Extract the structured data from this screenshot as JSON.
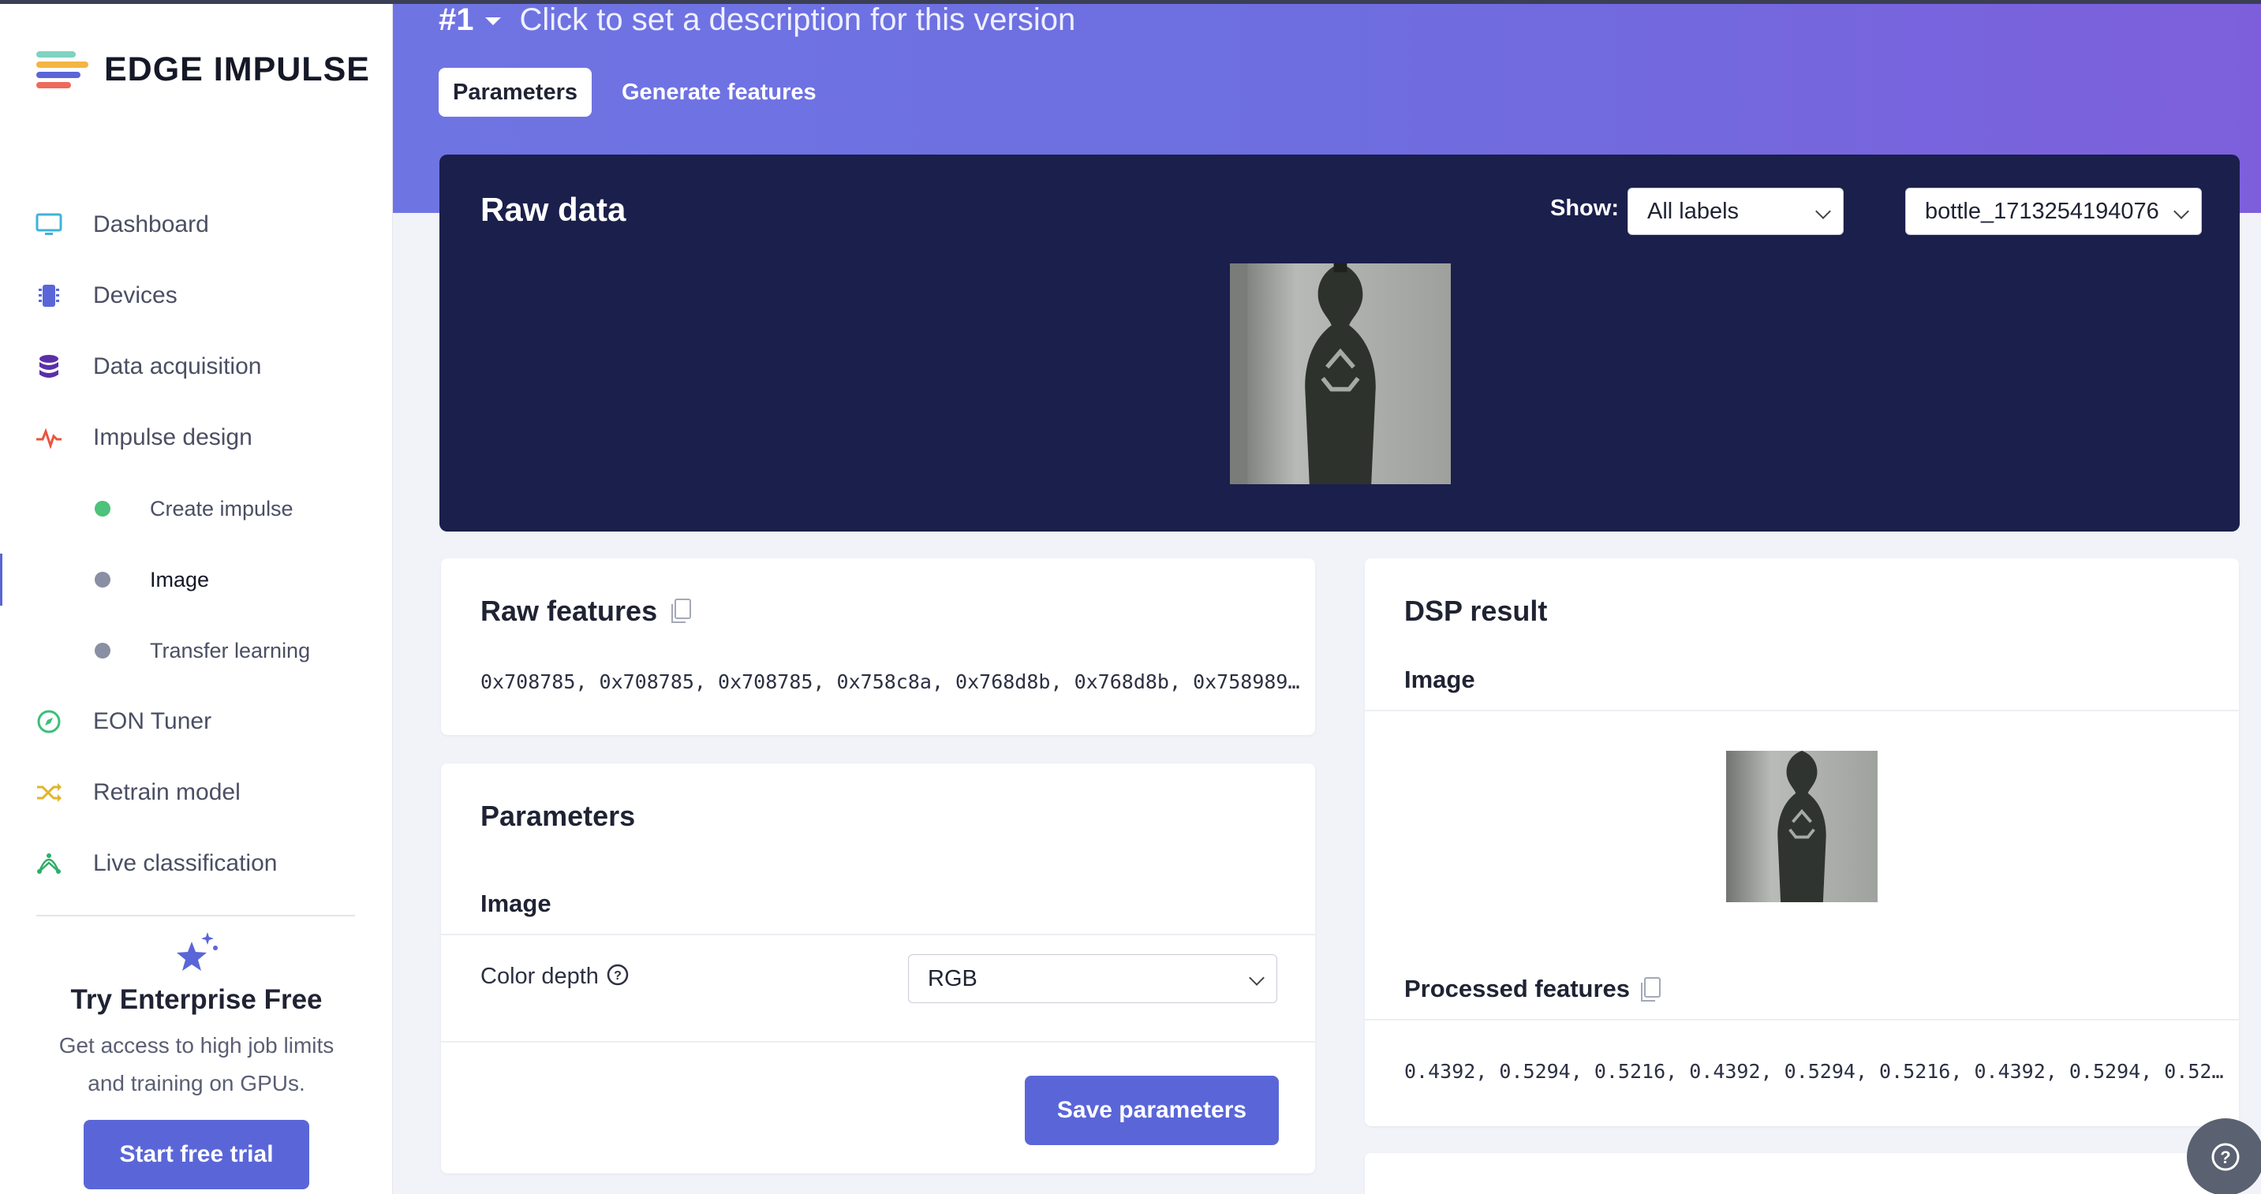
{
  "brand": {
    "name": "EDGE IMPULSE"
  },
  "sidebar": {
    "items": [
      {
        "label": "Dashboard",
        "icon": "monitor-icon"
      },
      {
        "label": "Devices",
        "icon": "chip-icon"
      },
      {
        "label": "Data acquisition",
        "icon": "database-icon"
      },
      {
        "label": "Impulse design",
        "icon": "pulse-icon"
      },
      {
        "label": "Create impulse",
        "icon": "green-dot-icon"
      },
      {
        "label": "Image",
        "icon": "gray-dot-icon"
      },
      {
        "label": "Transfer learning",
        "icon": "gray-dot-icon"
      },
      {
        "label": "EON Tuner",
        "icon": "compass-icon"
      },
      {
        "label": "Retrain model",
        "icon": "shuffle-icon"
      },
      {
        "label": "Live classification",
        "icon": "network-icon"
      }
    ],
    "trial": {
      "title": "Try Enterprise Free",
      "description": "Get access to high job limits and training on GPUs.",
      "button": "Start free trial"
    }
  },
  "header": {
    "version": "#1",
    "description": "Click to set a description for this version",
    "tabs": [
      {
        "label": "Parameters",
        "active": true
      },
      {
        "label": "Generate features",
        "active": false
      }
    ]
  },
  "raw_data": {
    "title": "Raw data",
    "show_label": "Show:",
    "label_filter": "All labels",
    "sample": "bottle_1713254194076"
  },
  "raw_features": {
    "title": "Raw features",
    "values": "0x708785, 0x708785, 0x708785, 0x758c8a, 0x768d8b, 0x768d8b, 0x758989…"
  },
  "parameters": {
    "title": "Parameters",
    "section": "Image",
    "color_depth_label": "Color depth",
    "color_depth_value": "RGB",
    "save_button": "Save parameters"
  },
  "dsp_result": {
    "title": "DSP result",
    "section": "Image",
    "processed_title": "Processed features",
    "processed_values": "0.4392, 0.5294, 0.5216, 0.4392, 0.5294, 0.5216, 0.4392, 0.5294, 0.52…"
  },
  "colors": {
    "accent": "#5a66d8",
    "header_start": "#6f74e3",
    "header_end": "#7d5fdc",
    "raw_panel": "#1b1f4b"
  }
}
